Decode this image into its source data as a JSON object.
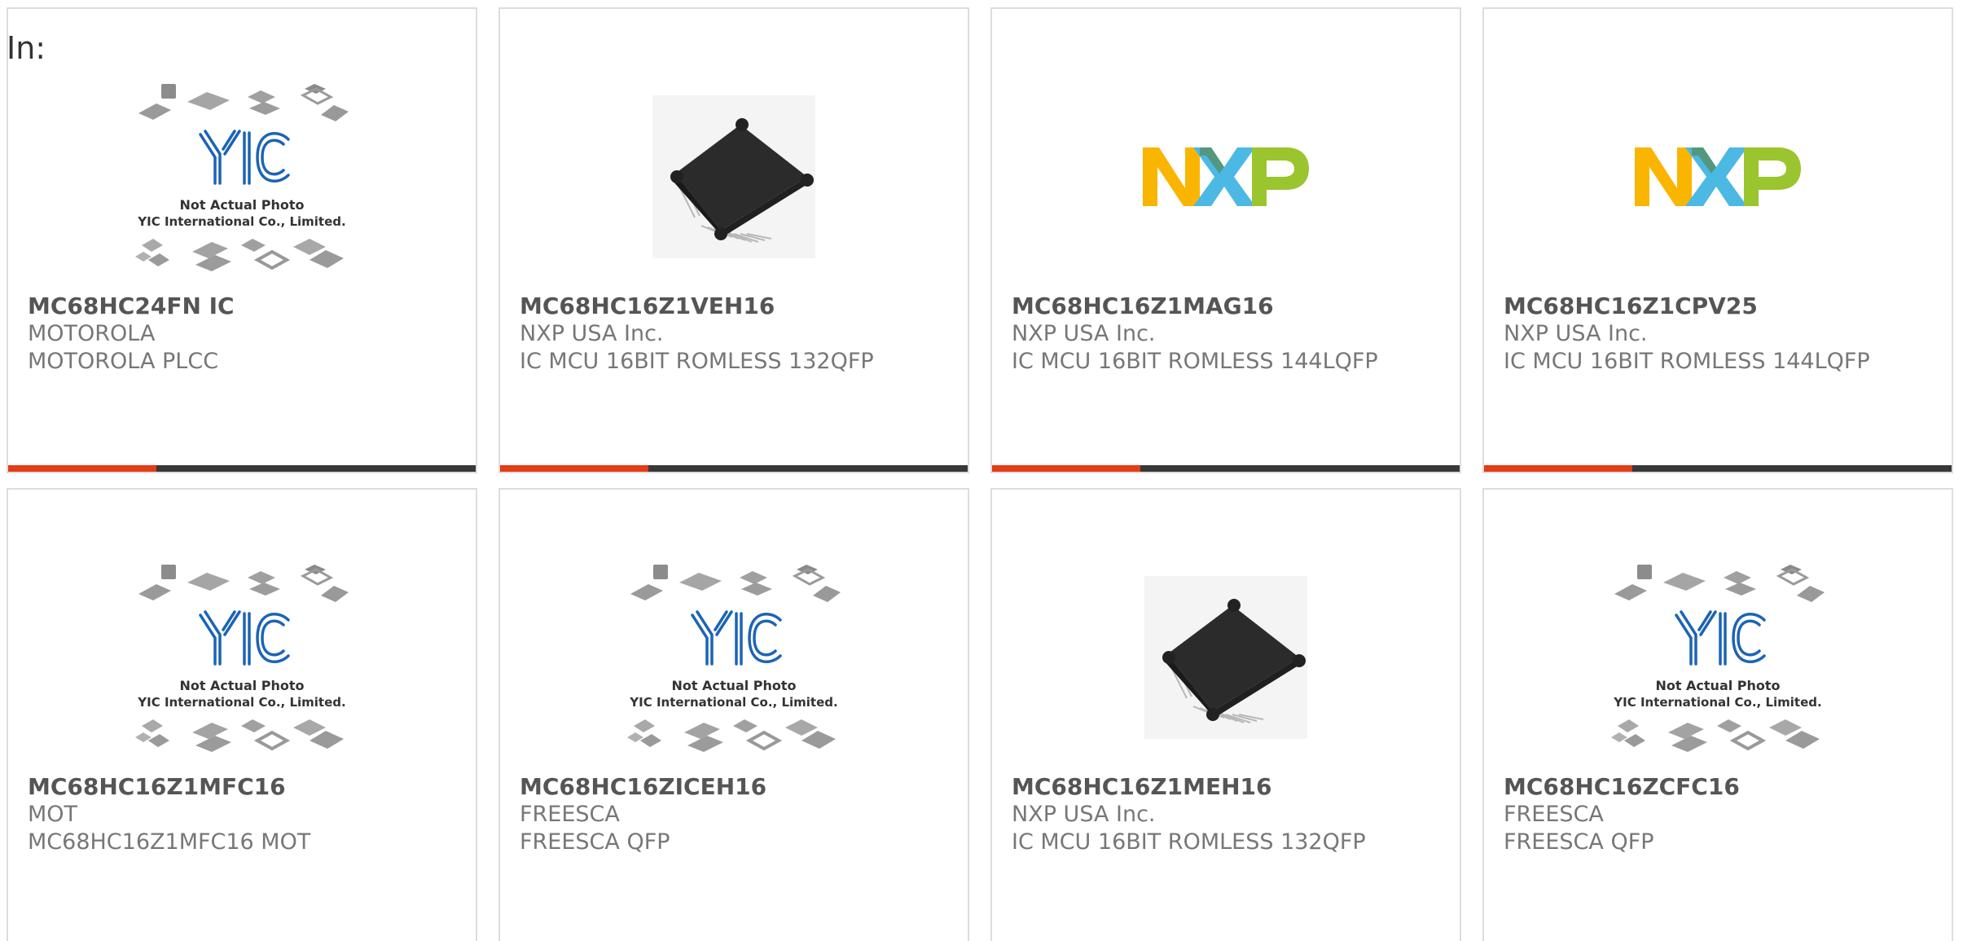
{
  "header": {
    "in_label": "In:"
  },
  "colors": {
    "accent": "#e33c16",
    "bar": "#383838",
    "text": "#555555",
    "subtext": "#777777",
    "nxp_orange": "#f9b500",
    "nxp_blue": "#4cb8e4",
    "nxp_green": "#9ac52e"
  },
  "placeholder_image": {
    "icon": "yic-placeholder-icon",
    "line1": "Not Actual Photo",
    "line2": "YIC International Co., Limited."
  },
  "nxp_logo": {
    "icon": "nxp-logo-icon",
    "text": "NXP"
  },
  "products": [
    {
      "part": "MC68HC24FN IC",
      "manufacturer": "MOTOROLA",
      "description": "MOTOROLA PLCC",
      "image": "yic-placeholder"
    },
    {
      "part": "MC68HC16Z1VEH16",
      "manufacturer": "NXP USA Inc.",
      "description": "IC MCU 16BIT ROMLESS 132QFP",
      "image": "qfp-chip"
    },
    {
      "part": "MC68HC16Z1MAG16",
      "manufacturer": "NXP USA Inc.",
      "description": "IC MCU 16BIT ROMLESS 144LQFP",
      "image": "nxp-logo"
    },
    {
      "part": "MC68HC16Z1CPV25",
      "manufacturer": "NXP USA Inc.",
      "description": "IC MCU 16BIT ROMLESS 144LQFP",
      "image": "nxp-logo"
    },
    {
      "part": "MC68HC16Z1MFC16",
      "manufacturer": "MOT",
      "description": "MC68HC16Z1MFC16 MOT",
      "image": "yic-placeholder"
    },
    {
      "part": "MC68HC16ZICEH16",
      "manufacturer": "FREESCA",
      "description": "FREESCA QFP",
      "image": "yic-placeholder"
    },
    {
      "part": "MC68HC16Z1MEH16",
      "manufacturer": "NXP USA Inc.",
      "description": "IC MCU 16BIT ROMLESS 132QFP",
      "image": "qfp-chip"
    },
    {
      "part": "MC68HC16ZCFC16",
      "manufacturer": "FREESCA",
      "description": "FREESCA QFP",
      "image": "yic-placeholder"
    }
  ]
}
